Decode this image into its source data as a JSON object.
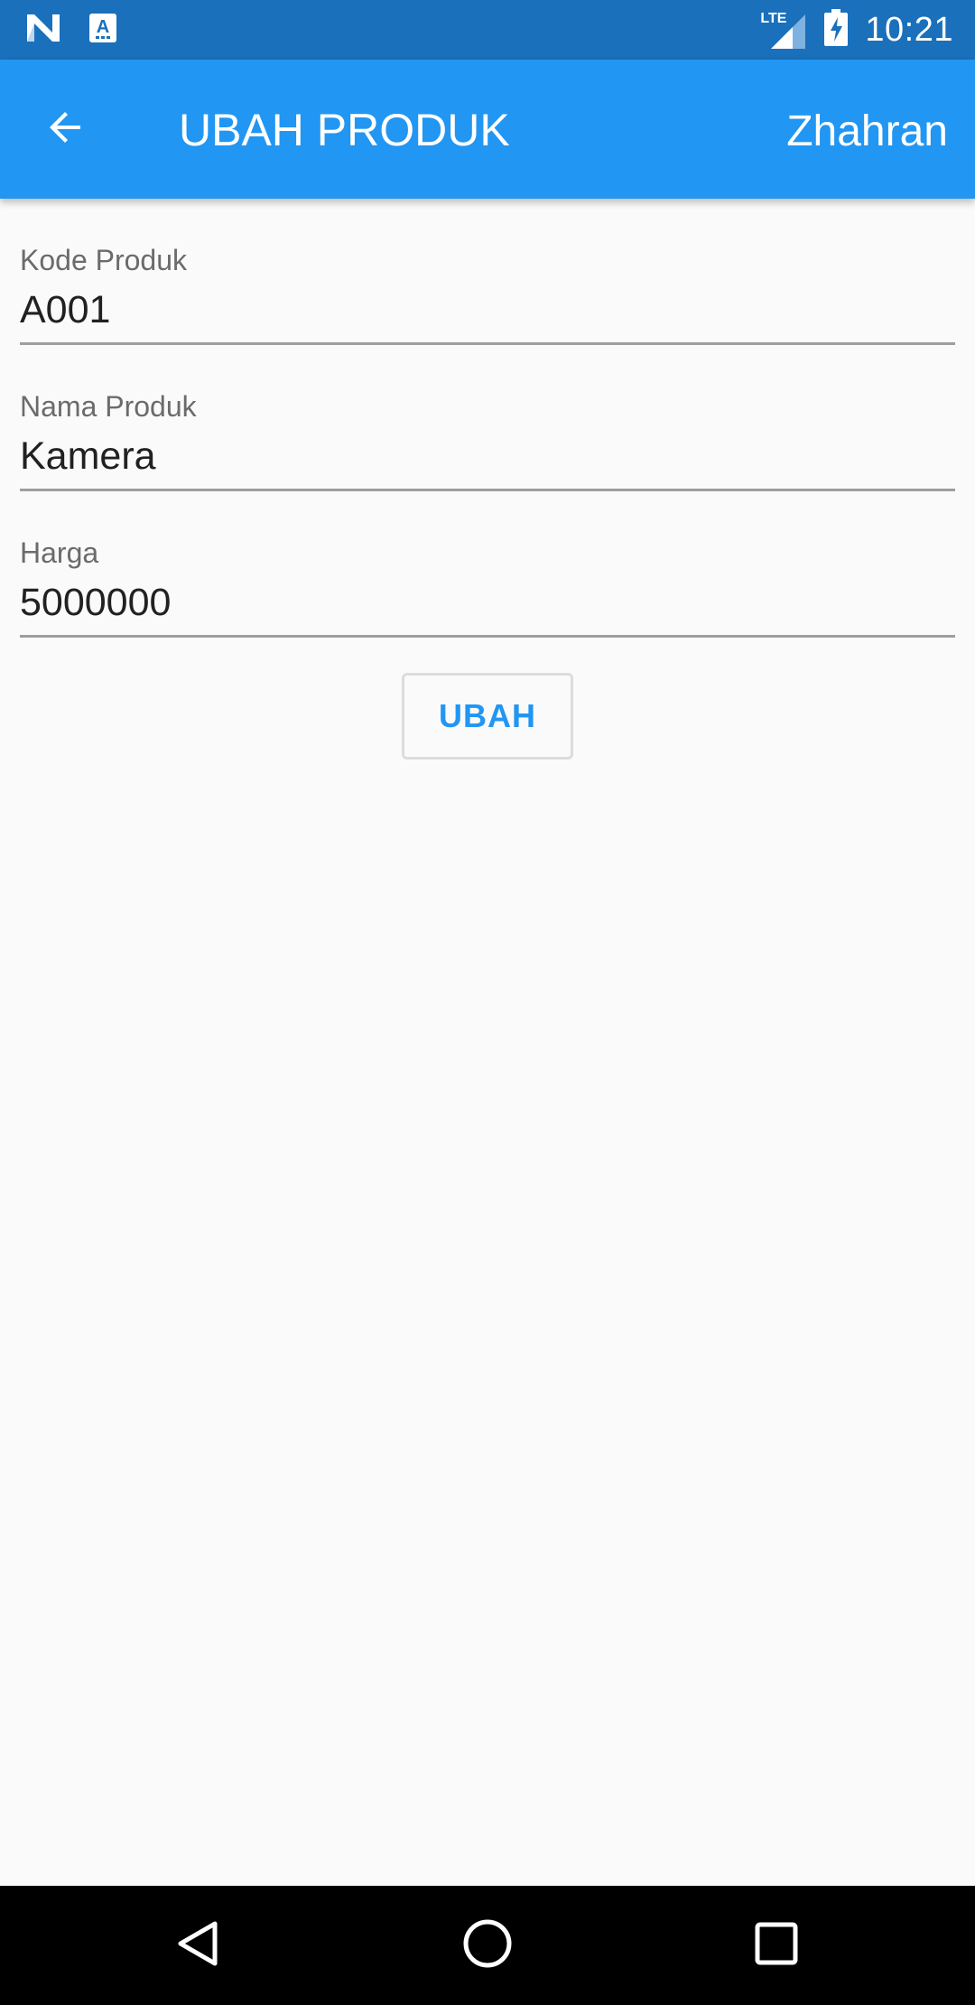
{
  "status_bar": {
    "time": "10:21",
    "network": "LTE",
    "icons": [
      "n-logo-icon",
      "a-notification-icon",
      "signal-icon",
      "battery-charging-icon"
    ]
  },
  "app_bar": {
    "title": "UBAH PRODUK",
    "action_label": "Zhahran",
    "back_icon": "arrow-back-icon"
  },
  "form": {
    "fields": [
      {
        "label": "Kode Produk",
        "value": "A001"
      },
      {
        "label": "Nama Produk",
        "value": "Kamera"
      },
      {
        "label": "Harga",
        "value": "5000000"
      }
    ],
    "submit_label": "UBAH"
  },
  "nav_bar": {
    "buttons": [
      "back-triangle-icon",
      "home-circle-icon",
      "recents-square-icon"
    ]
  },
  "colors": {
    "status_bar": "#1a70bb",
    "app_bar": "#2196f3",
    "accent": "#2196f3",
    "background": "#fafafa"
  }
}
